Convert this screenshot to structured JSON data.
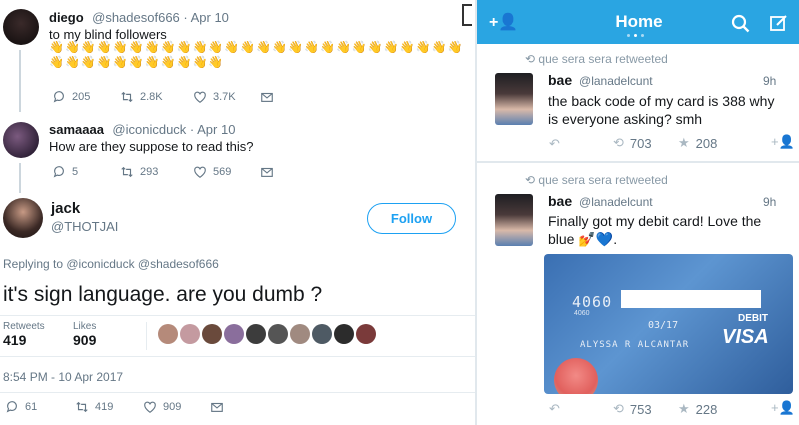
{
  "left": {
    "tweet1": {
      "name": "diego",
      "handle_date": "@shadesof666 · Apr 10",
      "text": "to my blind followers",
      "emojis": "👋👋👋👋👋👋👋👋👋👋👋👋👋👋👋👋👋👋👋👋👋👋👋👋👋👋👋👋👋👋👋👋👋👋👋👋👋",
      "replies": "205",
      "retweets": "2.8K",
      "likes": "3.7K"
    },
    "tweet2": {
      "name": "samaaaa",
      "handle_date": "@iconicduck · Apr 10",
      "text": "How are they suppose to read this?",
      "replies": "5",
      "retweets": "293",
      "likes": "569"
    },
    "tweet3": {
      "name": "jack",
      "handle": "@THOTJAI",
      "follow_label": "Follow",
      "replying_to": "Replying to @iconicduck @shadesof666",
      "text": "it's sign language. are you dumb ?",
      "retweets_label": "Retweets",
      "retweets_value": "419",
      "likes_label": "Likes",
      "likes_value": "909",
      "timestamp": "8:54 PM - 10 Apr 2017",
      "replies": "61",
      "retweets": "419",
      "likes": "909"
    }
  },
  "right": {
    "header_title": "Home",
    "tweet1": {
      "retweeted_by": "que sera sera retweeted",
      "name": "bae",
      "handle": "@lanadelcunt",
      "time": "9h",
      "text": "the back code of my card is 388 why is everyone asking? smh",
      "retweets": "703",
      "likes": "208"
    },
    "tweet2": {
      "retweeted_by": "que sera sera retweeted",
      "name": "bae",
      "handle": "@lanadelcunt",
      "time": "9h",
      "text": "Finally got my debit card! Love the blue 💅💙.",
      "retweets": "753",
      "likes": "228"
    },
    "card": {
      "number_prefix": "4060",
      "small_code": "4060",
      "expiry": "03/17",
      "debit_label": "DEBIT",
      "brand": "VISA",
      "holder": "ALYSSA R ALCANTAR"
    }
  }
}
